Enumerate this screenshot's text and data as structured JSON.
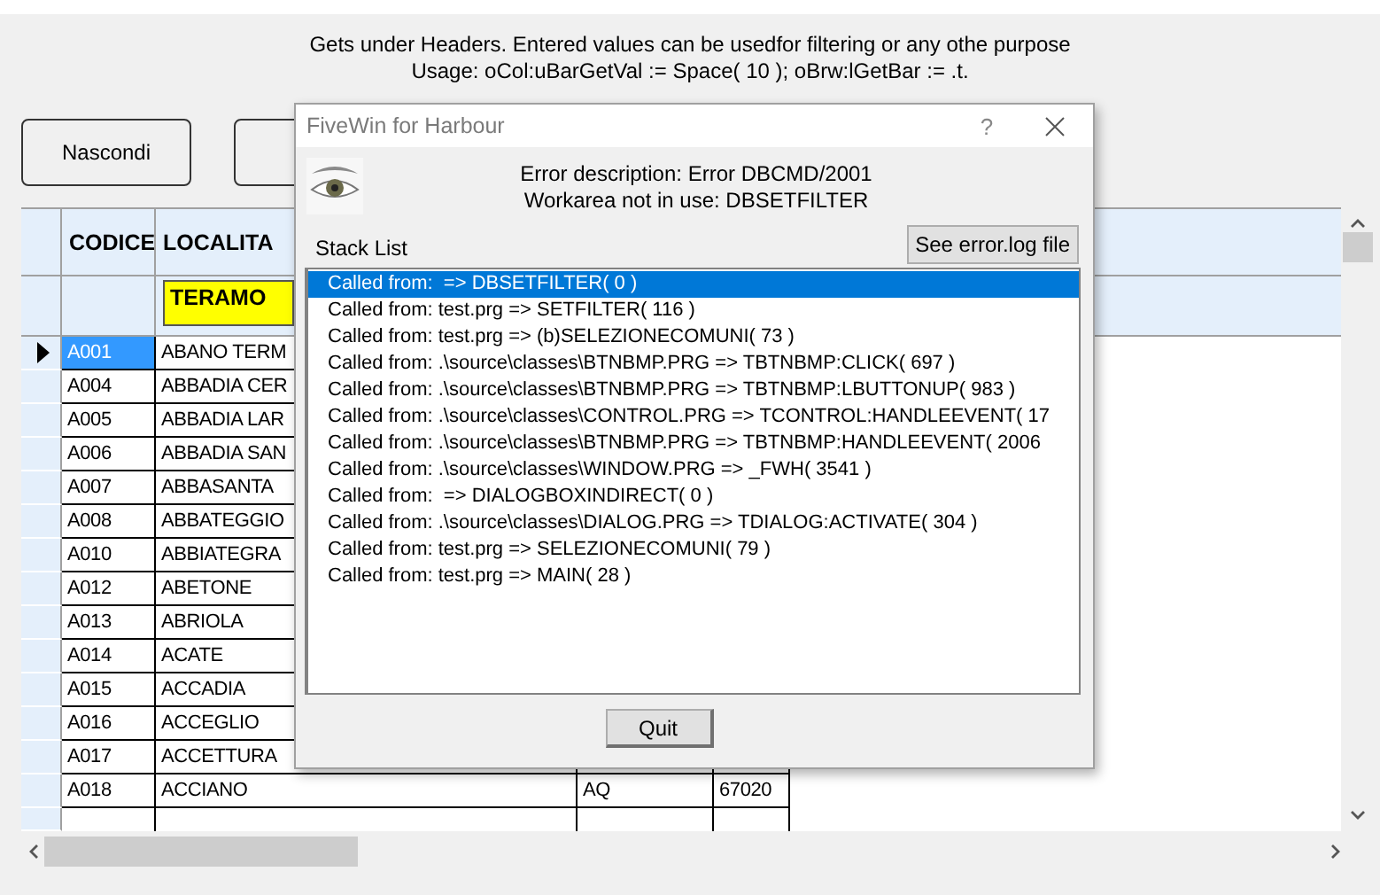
{
  "info_lines": [
    "Gets under Headers. Entered values can be usedfor filtering or any othe purpose",
    "Usage: oCol:uBarGetVal := Space( 10 ); oBrw:lGetBar := .t."
  ],
  "toolbar_buttons": [
    {
      "kind": "text",
      "label": "Nascondi"
    },
    {
      "kind": "blank"
    }
  ],
  "browse": {
    "columns": [
      "CODICE",
      "LOCALITA"
    ],
    "filter": {
      "value": "TERAMO"
    },
    "rows": [
      {
        "codice": "A001",
        "localita": "ABANO TERM",
        "selected": true
      },
      {
        "codice": "A004",
        "localita": "ABBADIA CER",
        "selected": false
      },
      {
        "codice": "A005",
        "localita": "ABBADIA LAR",
        "selected": false
      },
      {
        "codice": "A006",
        "localita": "ABBADIA SAN",
        "selected": false
      },
      {
        "codice": "A007",
        "localita": "ABBASANTA",
        "selected": false
      },
      {
        "codice": "A008",
        "localita": "ABBATEGGIO",
        "selected": false
      },
      {
        "codice": "A010",
        "localita": "ABBIATEGRA",
        "selected": false
      },
      {
        "codice": "A012",
        "localita": "ABETONE",
        "selected": false
      },
      {
        "codice": "A013",
        "localita": "ABRIOLA",
        "selected": false
      },
      {
        "codice": "A014",
        "localita": "ACATE",
        "selected": false
      },
      {
        "codice": "A015",
        "localita": "ACCADIA",
        "selected": false
      },
      {
        "codice": "A016",
        "localita": "ACCEGLIO",
        "selected": false
      },
      {
        "codice": "A017",
        "localita": "ACCETTURA",
        "selected": false
      },
      {
        "codice": "A018",
        "localita": "ACCIANO",
        "column_3": "AQ",
        "column_4": "67020",
        "selected": false
      }
    ]
  },
  "dialog": {
    "title": "FiveWin for Harbour",
    "help": "?",
    "error_lines": [
      "Error description: Error DBCMD/2001",
      "Workarea not in use: DBSETFILTER"
    ],
    "stack_label": "Stack List",
    "log_button": "See error.log file",
    "stack": [
      {
        "text": "Called from:  => DBSETFILTER( 0 )",
        "selected": true
      },
      {
        "text": "Called from: test.prg => SETFILTER( 116 )",
        "selected": false
      },
      {
        "text": "Called from: test.prg => (b)SELEZIONECOMUNI( 73 )",
        "selected": false
      },
      {
        "text": "Called from: .\\source\\classes\\BTNBMP.PRG => TBTNBMP:CLICK( 697 )",
        "selected": false
      },
      {
        "text": "Called from: .\\source\\classes\\BTNBMP.PRG => TBTNBMP:LBUTTONUP( 983 )",
        "selected": false
      },
      {
        "text": "Called from: .\\source\\classes\\CONTROL.PRG => TCONTROL:HANDLEEVENT( 17",
        "selected": false
      },
      {
        "text": "Called from: .\\source\\classes\\BTNBMP.PRG => TBTNBMP:HANDLEEVENT( 2006",
        "selected": false
      },
      {
        "text": "Called from: .\\source\\classes\\WINDOW.PRG => _FWH( 3541 )",
        "selected": false
      },
      {
        "text": "Called from:  => DIALOGBOXINDIRECT( 0 )",
        "selected": false
      },
      {
        "text": "Called from: .\\source\\classes\\DIALOG.PRG => TDIALOG:ACTIVATE( 304 )",
        "selected": false
      },
      {
        "text": "Called from: test.prg => SELEZIONECOMUNI( 79 )",
        "selected": false
      },
      {
        "text": "Called from: test.prg => MAIN( 28 )",
        "selected": false
      }
    ],
    "quit_button": "Quit"
  }
}
